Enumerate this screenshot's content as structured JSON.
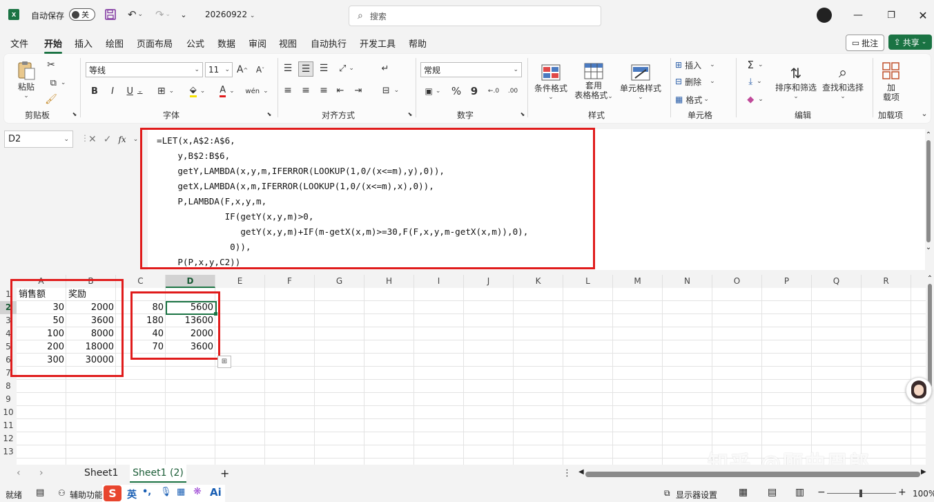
{
  "titlebar": {
    "autosave_label": "自动保存",
    "autosave_state": "关",
    "filename": "20260922",
    "search_placeholder": "搜索"
  },
  "menus": [
    "文件",
    "开始",
    "插入",
    "绘图",
    "页面布局",
    "公式",
    "数据",
    "审阅",
    "视图",
    "自动执行",
    "开发工具",
    "帮助"
  ],
  "comments_label": "批注",
  "share_label": "共享",
  "ribbon": {
    "clipboard": {
      "paste": "粘贴",
      "group": "剪贴板"
    },
    "font": {
      "name": "等线",
      "size": "11",
      "bold": "B",
      "italic": "I",
      "underline": "U",
      "wen": "wén",
      "group": "字体"
    },
    "alignment": {
      "group": "对齐方式"
    },
    "number": {
      "format": "常规",
      "percent": "%",
      "comma": "9",
      "group": "数字"
    },
    "styles": {
      "conditional": "条件格式",
      "table_format_1": "套用",
      "table_format_2": "表格格式",
      "cell_styles": "单元格样式",
      "group": "样式"
    },
    "cells": {
      "insert": "插入",
      "delete": "删除",
      "format": "格式",
      "group": "单元格"
    },
    "editing": {
      "sort": "排序和筛选",
      "find": "查找和选择",
      "group": "编辑"
    },
    "addins": {
      "label_1": "加",
      "label_2": "载项",
      "group": "加载项"
    }
  },
  "formula_bar": {
    "name_box": "D2",
    "fx": "fx",
    "formula": "=LET(x,A$2:A$6,\n    y,B$2:B$6,\n    getY,LAMBDA(x,y,m,IFERROR(LOOKUP(1,0/(x<=m),y),0)),\n    getX,LAMBDA(x,m,IFERROR(LOOKUP(1,0/(x<=m),x),0)),\n    P,LAMBDA(F,x,y,m,\n             IF(getY(x,y,m)>0,\n                getY(x,y,m)+IF(m-getX(x,m)>=30,F(F,x,y,m-getX(x,m)),0),\n              0)),\n    P(P,x,y,C2))"
  },
  "columns": [
    "A",
    "B",
    "C",
    "D",
    "E",
    "F",
    "G",
    "H",
    "I",
    "J",
    "K",
    "L",
    "M",
    "N",
    "O",
    "P",
    "Q",
    "R"
  ],
  "rows": [
    "1",
    "2",
    "3",
    "4",
    "5",
    "6",
    "7",
    "8",
    "9",
    "10",
    "11",
    "12",
    "13"
  ],
  "sheet": {
    "A1": "销售额",
    "B1": "奖励",
    "A": [
      "30",
      "50",
      "100",
      "200",
      "300"
    ],
    "B": [
      "2000",
      "3600",
      "8000",
      "18000",
      "30000"
    ],
    "C": [
      "80",
      "180",
      "40",
      "70"
    ],
    "D": [
      "5600",
      "13600",
      "2000",
      "3600"
    ]
  },
  "tabs": [
    "Sheet1",
    "Sheet1 (2)"
  ],
  "status": {
    "ready": "就绪",
    "accessibility": "辅助功能",
    "ime_lang": "英",
    "display_settings": "显示器设置",
    "zoom": "100%"
  },
  "watermark": "知乎 @顾曲周郎",
  "accent_color": "#1a7343",
  "highlight_color": "#e01b1b"
}
